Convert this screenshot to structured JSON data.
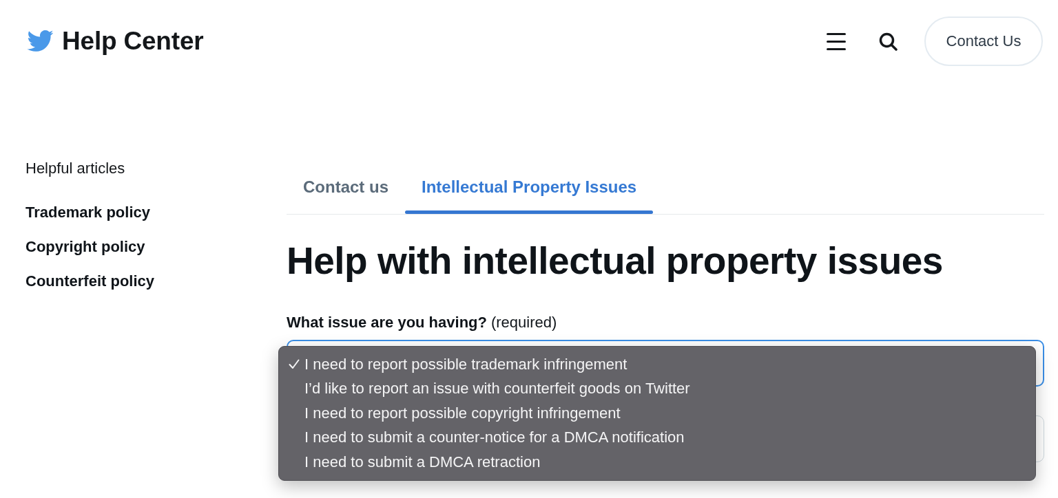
{
  "header": {
    "logo_text": "Help Center",
    "contact_button": "Contact Us"
  },
  "sidebar": {
    "heading": "Helpful articles",
    "items": [
      "Trademark policy",
      "Copyright policy",
      "Counterfeit policy"
    ]
  },
  "tabs": [
    {
      "label": "Contact us",
      "selected": false
    },
    {
      "label": "Intellectual Property Issues",
      "selected": true
    }
  ],
  "page_title": "Help with intellectual property issues",
  "issue_field": {
    "label": "What issue are you having?",
    "required_note": "(required)",
    "focused": true,
    "options": [
      {
        "label": "I need to report possible trademark infringement",
        "selected": true
      },
      {
        "label": "I’d like to report an issue with counterfeit goods on Twitter",
        "selected": false
      },
      {
        "label": "I need to report possible copyright infringement",
        "selected": false
      },
      {
        "label": "I need to submit a counter-notice for a DMCA notification",
        "selected": false
      },
      {
        "label": "I need to submit a DMCA retraction",
        "selected": false
      }
    ]
  }
}
